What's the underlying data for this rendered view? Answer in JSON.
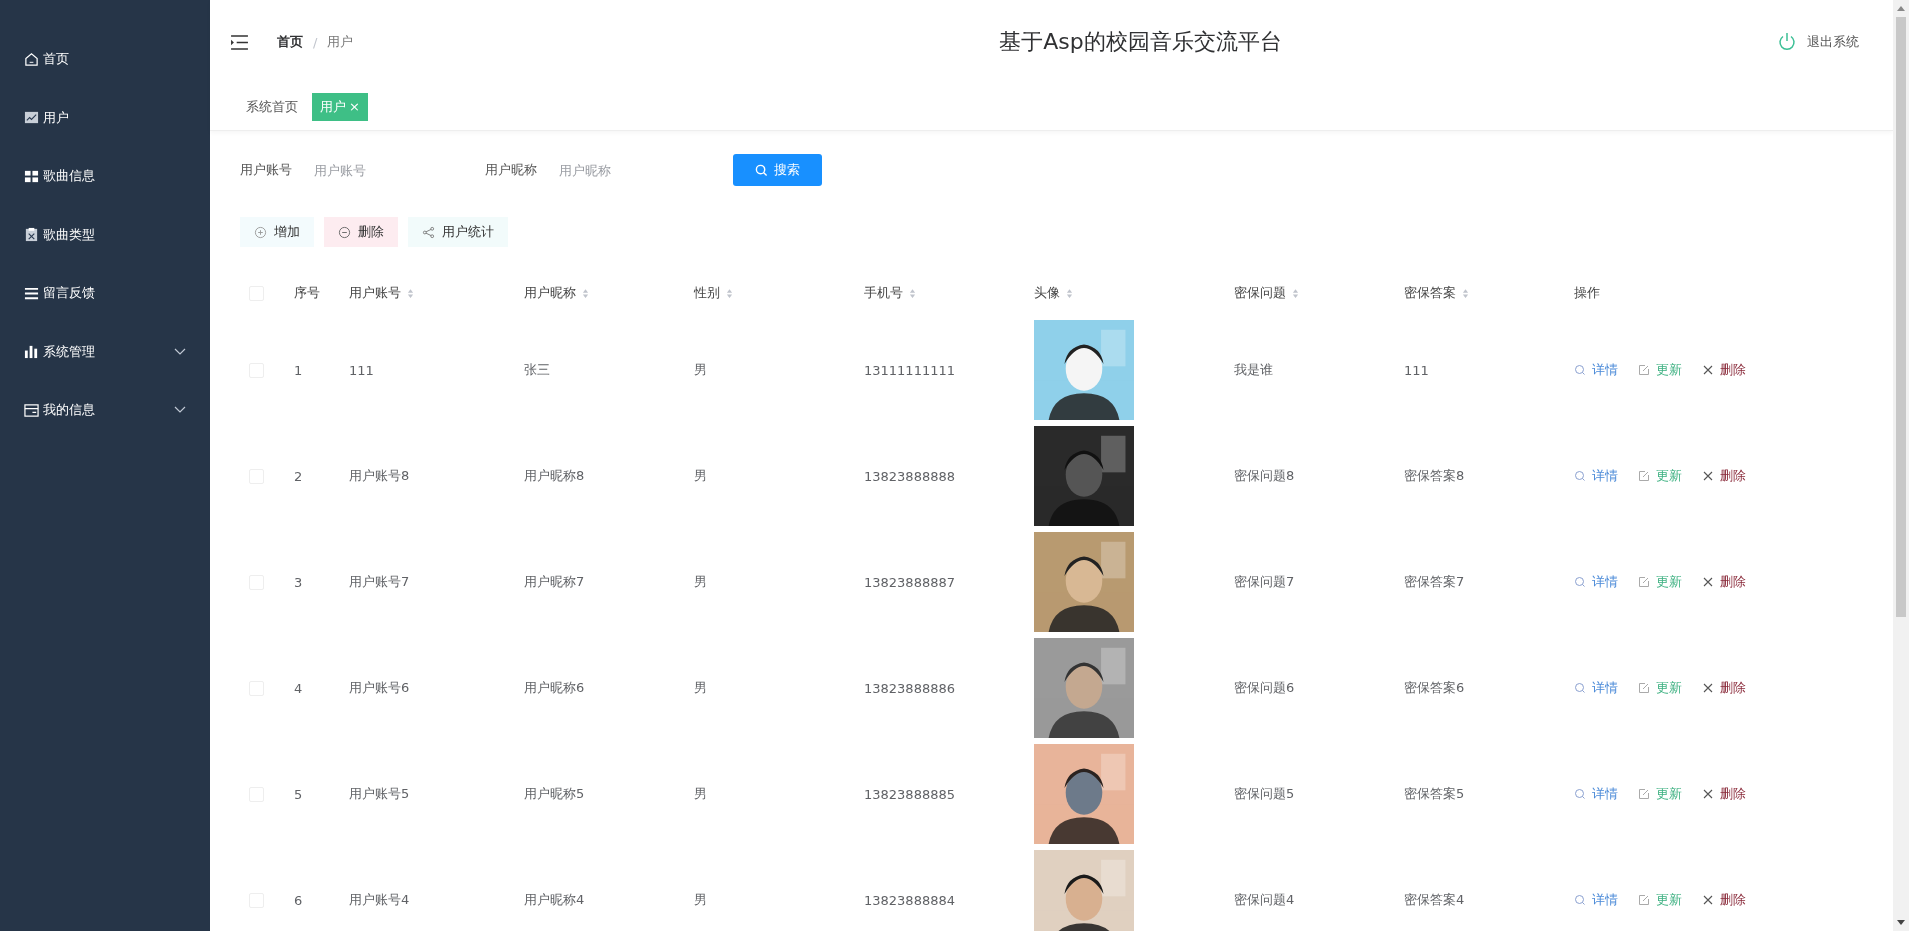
{
  "sidebar": {
    "items": [
      {
        "label": "首页"
      },
      {
        "label": "用户"
      },
      {
        "label": "歌曲信息"
      },
      {
        "label": "歌曲类型"
      },
      {
        "label": "留言反馈"
      },
      {
        "label": "系统管理",
        "expanded": false
      },
      {
        "label": "我的信息",
        "expanded": false
      }
    ]
  },
  "header": {
    "breadcrumb": [
      {
        "label": "首页"
      },
      {
        "label": "用户"
      }
    ],
    "breadcrumb_separator": "/",
    "title": "基于Asp的校园音乐交流平台",
    "logout": "退出系统"
  },
  "tabs": [
    {
      "label": "系统首页",
      "selected": false,
      "closable": false
    },
    {
      "label": "用户",
      "selected": true,
      "closable": true,
      "close": "×"
    }
  ],
  "search": {
    "fields": [
      {
        "label": "用户账号",
        "placeholder": "用户账号"
      },
      {
        "label": "用户昵称",
        "placeholder": "用户昵称"
      }
    ],
    "button": "搜索"
  },
  "actions": [
    {
      "kind": "add",
      "label": "增加"
    },
    {
      "kind": "delete",
      "label": "删除"
    },
    {
      "kind": "stats",
      "label": "用户统计"
    }
  ],
  "table": {
    "select_all": {
      "checked": false
    },
    "columns": [
      {
        "label": "序号",
        "sortable": false
      },
      {
        "label": "用户账号",
        "sortable": true
      },
      {
        "label": "用户昵称",
        "sortable": true
      },
      {
        "label": "性别",
        "sortable": true
      },
      {
        "label": "手机号",
        "sortable": true
      },
      {
        "label": "头像",
        "sortable": true
      },
      {
        "label": "密保问题",
        "sortable": true
      },
      {
        "label": "密保答案",
        "sortable": true
      },
      {
        "label": "操作",
        "sortable": false
      }
    ],
    "rows": [
      {
        "checked": false,
        "cells": [
          "1",
          "111",
          "张三",
          "男",
          "13111111111"
        ],
        "avatar": {
          "kind": "picture"
        },
        "cells_after": [
          "我是谁",
          "111"
        ],
        "ops": [
          {
            "kind": "detail",
            "label": "详情"
          },
          {
            "kind": "update",
            "label": "更新"
          },
          {
            "kind": "remove",
            "label": "删除"
          }
        ]
      },
      {
        "checked": false,
        "cells": [
          "2",
          "用户账号8",
          "用户昵称8",
          "男",
          "13823888888"
        ],
        "avatar": {
          "kind": "picture"
        },
        "cells_after": [
          "密保问题8",
          "密保答案8"
        ],
        "ops": [
          {
            "kind": "detail",
            "label": "详情"
          },
          {
            "kind": "update",
            "label": "更新"
          },
          {
            "kind": "remove",
            "label": "删除"
          }
        ]
      },
      {
        "checked": false,
        "cells": [
          "3",
          "用户账号7",
          "用户昵称7",
          "男",
          "13823888887"
        ],
        "avatar": {
          "kind": "picture"
        },
        "cells_after": [
          "密保问题7",
          "密保答案7"
        ],
        "ops": [
          {
            "kind": "detail",
            "label": "详情"
          },
          {
            "kind": "update",
            "label": "更新"
          },
          {
            "kind": "remove",
            "label": "删除"
          }
        ]
      },
      {
        "checked": false,
        "cells": [
          "4",
          "用户账号6",
          "用户昵称6",
          "男",
          "13823888886"
        ],
        "avatar": {
          "kind": "picture"
        },
        "cells_after": [
          "密保问题6",
          "密保答案6"
        ],
        "ops": [
          {
            "kind": "detail",
            "label": "详情"
          },
          {
            "kind": "update",
            "label": "更新"
          },
          {
            "kind": "remove",
            "label": "删除"
          }
        ]
      },
      {
        "checked": false,
        "cells": [
          "5",
          "用户账号5",
          "用户昵称5",
          "男",
          "13823888885"
        ],
        "avatar": {
          "kind": "picture"
        },
        "cells_after": [
          "密保问题5",
          "密保答案5"
        ],
        "ops": [
          {
            "kind": "detail",
            "label": "详情"
          },
          {
            "kind": "update",
            "label": "更新"
          },
          {
            "kind": "remove",
            "label": "删除"
          }
        ]
      },
      {
        "checked": false,
        "cells": [
          "6",
          "用户账号4",
          "用户昵称4",
          "男",
          "13823888884"
        ],
        "avatar": {
          "kind": "picture"
        },
        "cells_after": [
          "密保问题4",
          "密保答案4"
        ],
        "ops": [
          {
            "kind": "detail",
            "label": "详情"
          },
          {
            "kind": "update",
            "label": "更新"
          },
          {
            "kind": "remove",
            "label": "删除"
          }
        ]
      }
    ]
  }
}
